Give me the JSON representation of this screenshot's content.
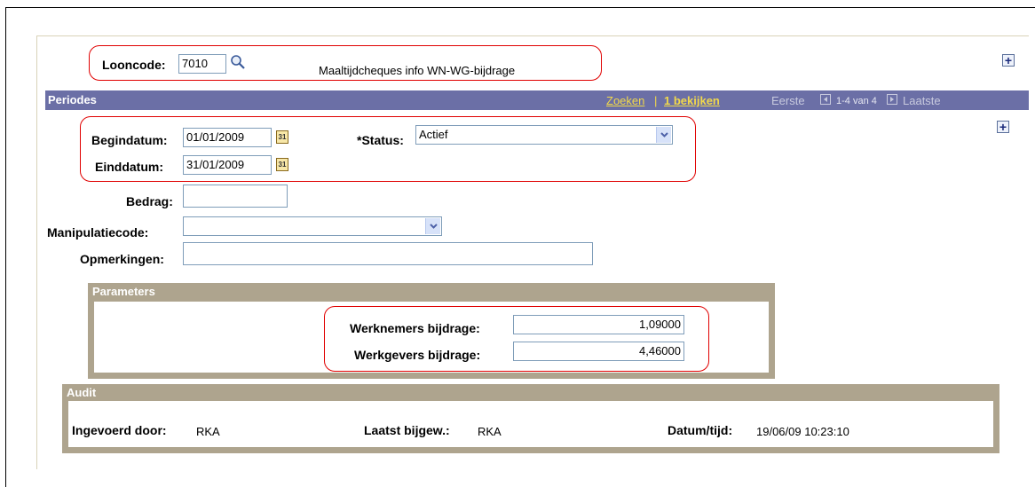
{
  "header": {
    "looncode_label": "Looncode:",
    "looncode_value": "7010",
    "looncode_description": "Maaltijdcheques info WN-WG-bijdrage"
  },
  "periodes": {
    "title": "Periodes",
    "search_link": "Zoeken",
    "separator": "|",
    "view_link": "1 bekijken",
    "first": "Eerste",
    "range": "1-4 van 4",
    "last": "Laatste"
  },
  "form": {
    "begindatum_label": "Begindatum:",
    "begindatum_value": "01/01/2009",
    "einddatum_label": "Einddatum:",
    "einddatum_value": "31/01/2009",
    "status_label": "*Status:",
    "status_value": "Actief",
    "bedrag_label": "Bedrag:",
    "bedrag_value": "",
    "manipulatiecode_label": "Manipulatiecode:",
    "manipulatiecode_value": "",
    "opmerkingen_label": "Opmerkingen:",
    "opmerkingen_value": "",
    "calendar_glyph": "31"
  },
  "parameters": {
    "title": "Parameters",
    "werknemers_label": "Werknemers bijdrage:",
    "werknemers_value": "1,09000",
    "werkgevers_label": "Werkgevers bijdrage:",
    "werkgevers_value": "4,46000"
  },
  "audit": {
    "title": "Audit",
    "ingevoerd_label": "Ingevoerd door:",
    "ingevoerd_value": "RKA",
    "laatst_label": "Laatst bijgew.:",
    "laatst_value": "RKA",
    "datum_label": "Datum/tijd:",
    "datum_value": "19/06/09 10:23:10"
  },
  "icons": {
    "plus": "+",
    "search": "search-icon",
    "calendar": "calendar-icon",
    "dropdown": "chevron-down-icon"
  },
  "colors": {
    "title_bar": "#6b6fa6",
    "section_bar": "#aea48e",
    "highlight": "#e00000",
    "link": "#f2d94a"
  }
}
